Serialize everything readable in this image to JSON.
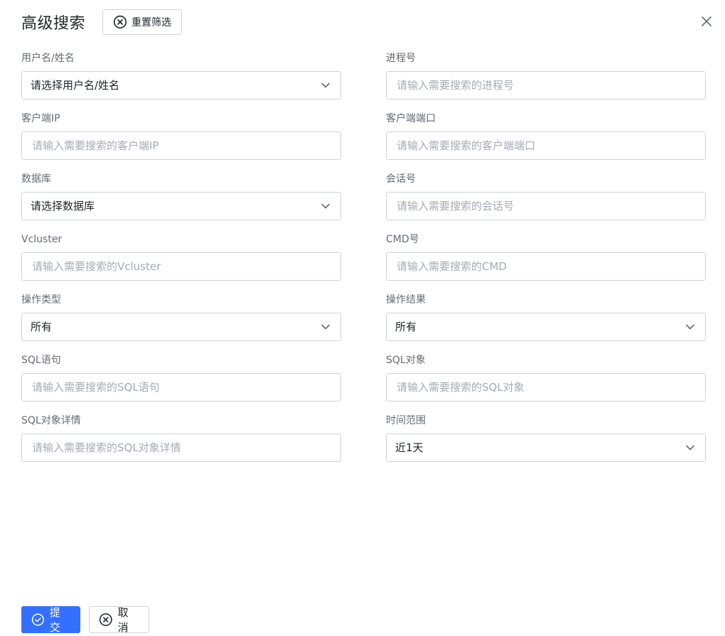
{
  "header": {
    "title": "高级搜索",
    "reset_label": "重置筛选"
  },
  "fields": {
    "username": {
      "label": "用户名/姓名",
      "placeholder": "请选择用户名/姓名",
      "value": "请选择用户名/姓名"
    },
    "process_no": {
      "label": "进程号",
      "placeholder": "请输入需要搜索的进程号"
    },
    "client_ip": {
      "label": "客户端IP",
      "placeholder": "请输入需要搜索的客户端IP"
    },
    "client_port": {
      "label": "客户端端口",
      "placeholder": "请输入需要搜索的客户端端口"
    },
    "database": {
      "label": "数据库",
      "value": "请选择数据库"
    },
    "session_no": {
      "label": "会话号",
      "placeholder": "请输入需要搜索的会话号"
    },
    "vcluster": {
      "label": "Vcluster",
      "placeholder": "请输入需要搜索的Vcluster"
    },
    "cmd_no": {
      "label": "CMD号",
      "placeholder": "请输入需要搜索的CMD"
    },
    "op_type": {
      "label": "操作类型",
      "value": "所有"
    },
    "op_result": {
      "label": "操作结果",
      "value": "所有"
    },
    "sql_statement": {
      "label": "SQL语句",
      "placeholder": "请输入需要搜索的SQL语句"
    },
    "sql_object": {
      "label": "SQL对象",
      "placeholder": "请输入需要搜索的SQL对象"
    },
    "sql_object_detail": {
      "label": "SQL对象详情",
      "placeholder": "请输入需要搜索的SQL对象详情"
    },
    "time_range": {
      "label": "时间范围",
      "value": "近1天"
    }
  },
  "footer": {
    "submit_label": "提交",
    "cancel_label": "取消"
  },
  "colors": {
    "primary": "#3370ff",
    "border": "#d0d3d9",
    "label": "#646a73",
    "placeholder": "#a6aab2"
  }
}
